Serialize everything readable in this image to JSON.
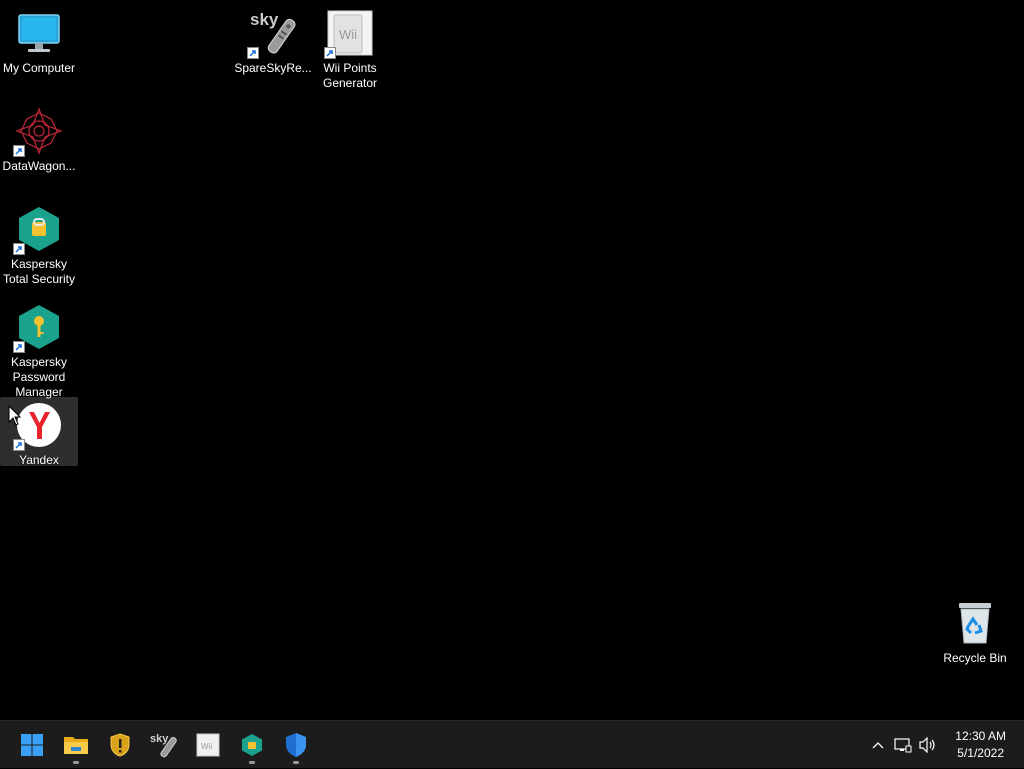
{
  "desktop": {
    "icons": {
      "my_computer": {
        "label": "My Computer"
      },
      "datawagon": {
        "label": "DataWagon..."
      },
      "kaspersky_ts": {
        "label": "Kaspersky\nTotal Security"
      },
      "kaspersky_pm": {
        "label": "Kaspersky\nPassword\nManager"
      },
      "yandex": {
        "label": "Yandex"
      },
      "spareskyre": {
        "label": "SpareSkyRe..."
      },
      "wii_points": {
        "label": "Wii Points\nGenerator"
      },
      "recycle_bin": {
        "label": "Recycle Bin"
      }
    },
    "selected_icon": "yandex"
  },
  "taskbar": {
    "pinned": [
      {
        "name": "start",
        "icon": "windows-logo-icon"
      },
      {
        "name": "file-explorer",
        "icon": "folder-icon",
        "running": true
      },
      {
        "name": "security-shield",
        "icon": "shield-warning-icon"
      },
      {
        "name": "sky",
        "icon": "sky-remote-icon"
      },
      {
        "name": "wii",
        "icon": "wii-icon"
      },
      {
        "name": "kaspersky",
        "icon": "kaspersky-icon",
        "running": true
      },
      {
        "name": "defender",
        "icon": "defender-shield-icon",
        "running": true
      }
    ],
    "clock": {
      "time": "12:30 AM",
      "date": "5/1/2022"
    }
  },
  "colors": {
    "desktop_bg": "#000000",
    "taskbar_bg": "#1c1c1c",
    "accent": "#0a84ff"
  }
}
